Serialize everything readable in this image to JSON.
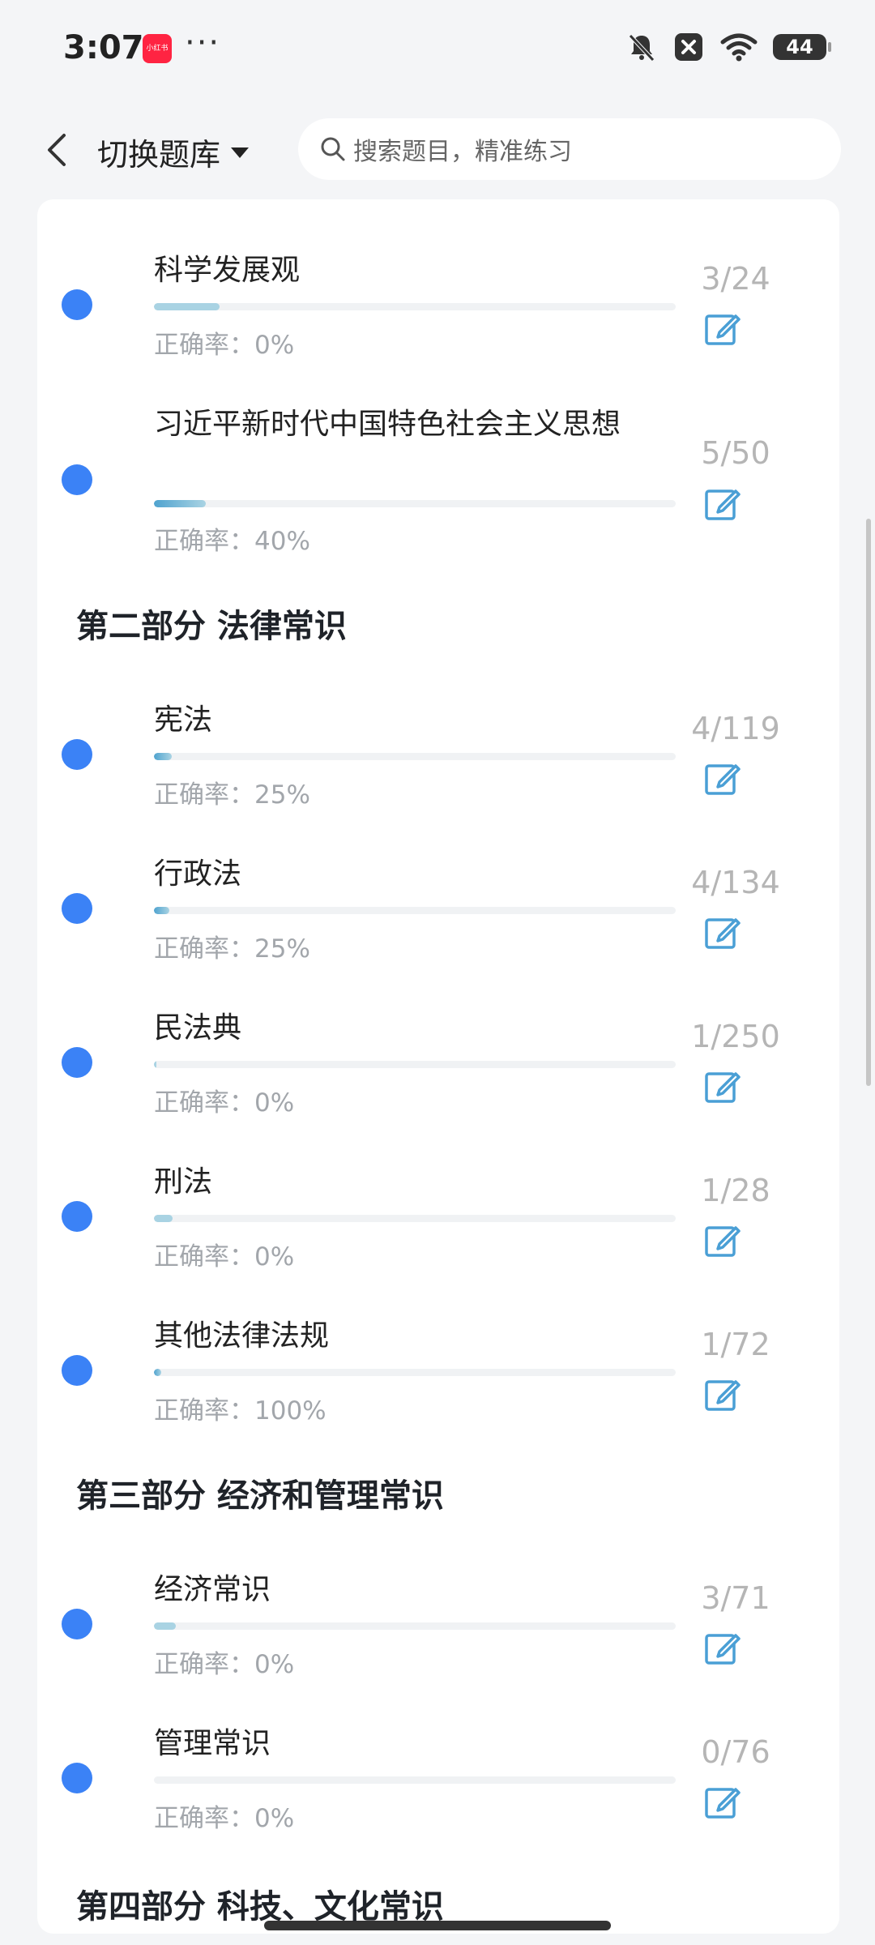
{
  "status_bar": {
    "time": "3:07",
    "app_badge": "小红书",
    "dots": "···",
    "battery": "44",
    "icons": [
      "bell-off-icon",
      "close-box-icon",
      "wifi-icon",
      "battery-icon"
    ]
  },
  "nav": {
    "back_icon": "chevron-left-icon",
    "bank_switch_label": "切换题库",
    "search_placeholder": "搜索题目，精准练习"
  },
  "colors": {
    "dot": "#3b82f6",
    "progress": "#a9d3e3",
    "accent_text": "#1f2329"
  },
  "items": [
    {
      "title": "科学发展观",
      "accuracy": "正确率：0%",
      "count": "3/24",
      "progress": 0.125
    },
    {
      "title": "习近平新时代中国特色社会主义思想",
      "accuracy": "正确率：40%",
      "count": "5/50",
      "progress": 0.1
    },
    {
      "title": "宪法",
      "accuracy": "正确率：25%",
      "count": "4/119",
      "progress": 0.034
    },
    {
      "title": "行政法",
      "accuracy": "正确率：25%",
      "count": "4/134",
      "progress": 0.03
    },
    {
      "title": "民法典",
      "accuracy": "正确率：0%",
      "count": "1/250",
      "progress": 0.004
    },
    {
      "title": "刑法",
      "accuracy": "正确率：0%",
      "count": "1/28",
      "progress": 0.036
    },
    {
      "title": "其他法律法规",
      "accuracy": "正确率：100%",
      "count": "1/72",
      "progress": 0.014
    },
    {
      "title": "经济常识",
      "accuracy": "正确率：0%",
      "count": "3/71",
      "progress": 0.042
    },
    {
      "title": "管理常识",
      "accuracy": "正确率：0%",
      "count": "0/76",
      "progress": 0
    }
  ],
  "sections": [
    {
      "title": "第二部分  法律常识"
    },
    {
      "title": "第三部分  经济和管理常识"
    },
    {
      "title": "第四部分  科技、文化常识"
    }
  ]
}
